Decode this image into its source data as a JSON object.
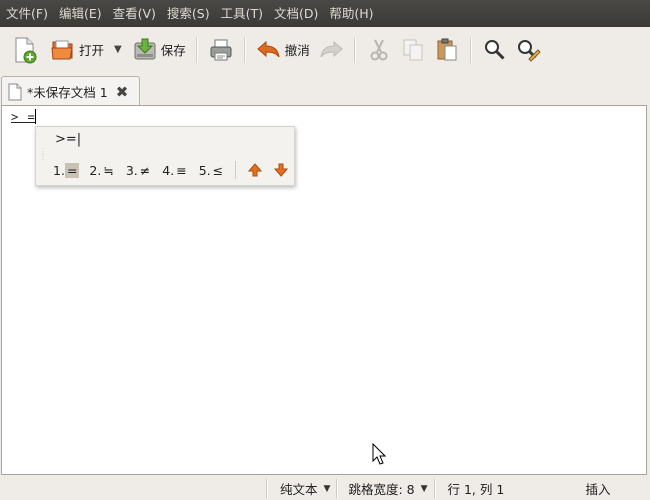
{
  "menu": [
    "文件(F)",
    "编辑(E)",
    "查看(V)",
    "搜索(S)",
    "工具(T)",
    "文档(D)",
    "帮助(H)"
  ],
  "toolbar": {
    "open_label": "打开",
    "save_label": "保存",
    "undo_label": "撤消"
  },
  "tab": {
    "title": "*未保存文档 1"
  },
  "editor": {
    "text": "> ="
  },
  "ime": {
    "preedit": ">=|",
    "candidates": [
      {
        "index": "1.",
        "char": "="
      },
      {
        "index": "2.",
        "char": "≒"
      },
      {
        "index": "3.",
        "char": "≠"
      },
      {
        "index": "4.",
        "char": "≡"
      },
      {
        "index": "5.",
        "char": "≤"
      }
    ]
  },
  "status": {
    "mode": "纯文本",
    "tab_width": "跳格宽度: 8",
    "position": "行 1, 列 1",
    "insert": "插入"
  },
  "colors": {
    "menubar": "#3c3b37",
    "undo_arrow": "#e06a1f",
    "ime_arrow": "#e8701d"
  }
}
